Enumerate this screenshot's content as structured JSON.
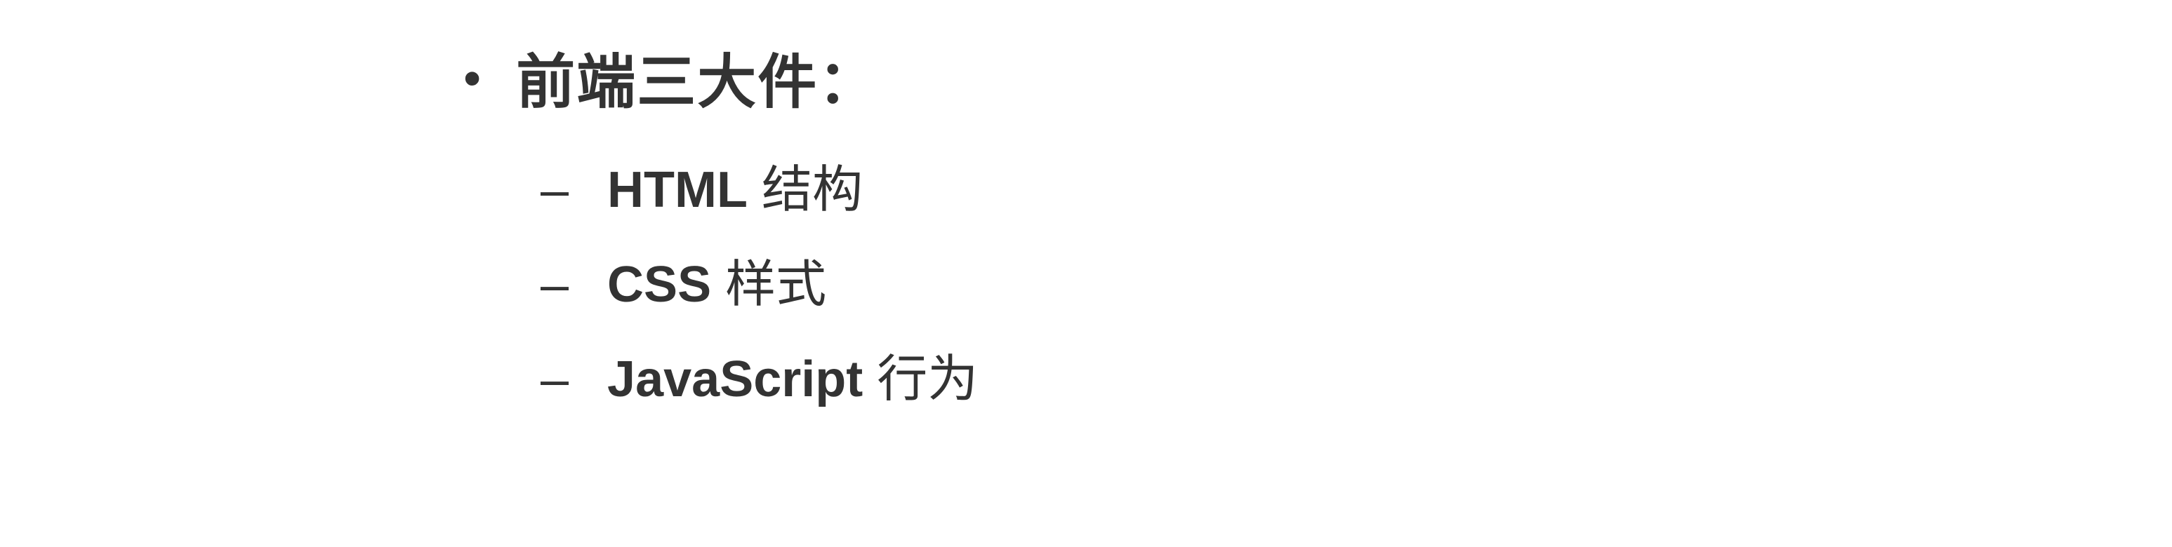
{
  "list": {
    "mainBullet": "•",
    "mainText": "前端三大件：",
    "subDash": "–",
    "items": [
      {
        "bold": "HTML",
        "rest": " 结构"
      },
      {
        "bold": "CSS",
        "rest": " 样式"
      },
      {
        "bold": "JavaScript",
        "rest": " 行为"
      }
    ]
  }
}
